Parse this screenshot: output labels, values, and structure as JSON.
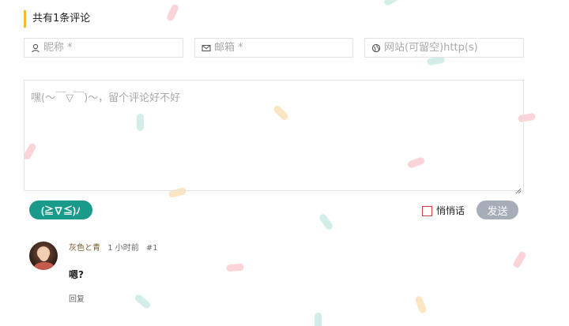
{
  "header": {
    "title": "共有1条评论"
  },
  "form": {
    "nickname": {
      "placeholder": "昵称 *",
      "icon": "user-icon"
    },
    "email": {
      "placeholder": "邮箱 *",
      "icon": "mail-icon"
    },
    "website": {
      "placeholder": "网站(可留空)http(s)",
      "icon": "globe-icon"
    },
    "comment": {
      "placeholder": "嘿(～￣▽￣)～，留个评论好不好"
    },
    "emoji_label": "(≧∇≦)ﾉ",
    "private_label": "悄悄话",
    "private_checked": false,
    "send_label": "发送"
  },
  "comments": [
    {
      "author": "灰色と青",
      "time": "1 小时前",
      "floor": "#1",
      "text": "嗯?",
      "reply_label": "回复"
    }
  ],
  "colors": {
    "accent": "#f5b82e",
    "emoji_button": "#1a9a8a",
    "send_button": "#a6adb8",
    "checkbox_border": "#d04040"
  }
}
